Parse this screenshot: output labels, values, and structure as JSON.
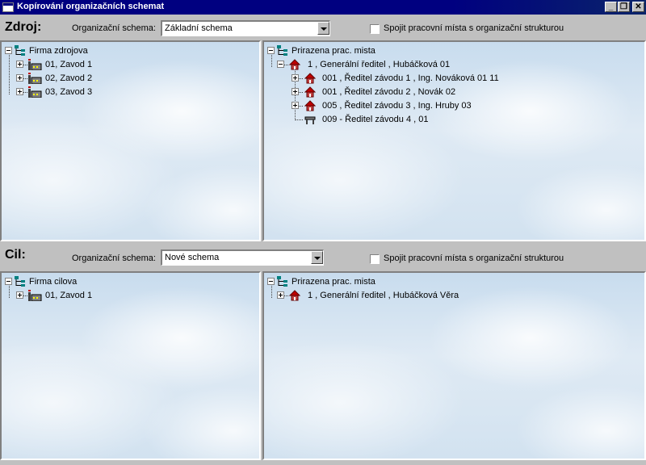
{
  "window": {
    "title": "Kopírování organizačních schemat"
  },
  "source": {
    "label": "Zdroj:",
    "schema_label": "Organizační schema:",
    "schema_value": "Základní schema",
    "merge_label": "Spojit pracovní místa s organizační strukturou",
    "merge_checked": false,
    "left_tree": {
      "root": "Firma zdrojova",
      "items": [
        "01,  Zavod 1",
        "02,  Zavod 2",
        "03,  Zavod 3"
      ]
    },
    "right_tree": {
      "root": "Prirazena prac. mista",
      "child": "1 , Generální ředitel ,  Hubáčková  01",
      "items": [
        "001 , Ředitel závodu 1 , Ing. Nováková  01  11",
        "001 , Ředitel závodu 2 ,  Novák  02",
        "005 , Ředitel závodu 3 , Ing. Hruby  03",
        "009 - Ředitel závodu 4  , 01"
      ]
    }
  },
  "target": {
    "label": "Cil:",
    "schema_label": "Organizační schema:",
    "schema_value": "Nové schema",
    "merge_label": "Spojit pracovní místa s organizační strukturou",
    "merge_checked": false,
    "left_tree": {
      "root": "Firma cilova",
      "items": [
        "01,  Zavod 1"
      ]
    },
    "right_tree": {
      "root": "Prirazena prac. mista",
      "child": "1 , Generální ředitel ,  Hubáčková Věra"
    }
  }
}
